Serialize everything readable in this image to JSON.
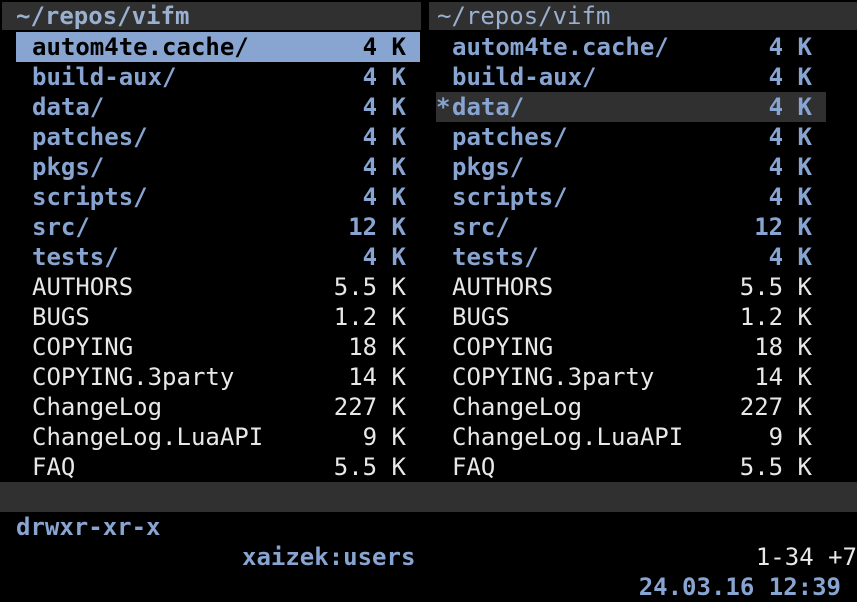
{
  "left_pane": {
    "path": "~/repos/vifm",
    "files": [
      {
        "name": "autom4te.cache/",
        "size": "4 K",
        "type": "dir",
        "cursor": true
      },
      {
        "name": "build-aux/",
        "size": "4 K",
        "type": "dir"
      },
      {
        "name": "data/",
        "size": "4 K",
        "type": "dir"
      },
      {
        "name": "patches/",
        "size": "4 K",
        "type": "dir"
      },
      {
        "name": "pkgs/",
        "size": "4 K",
        "type": "dir"
      },
      {
        "name": "scripts/",
        "size": "4 K",
        "type": "dir"
      },
      {
        "name": "src/",
        "size": "12 K",
        "type": "dir"
      },
      {
        "name": "tests/",
        "size": "4 K",
        "type": "dir"
      },
      {
        "name": "AUTHORS",
        "size": "5.5 K",
        "type": "file"
      },
      {
        "name": "BUGS",
        "size": "1.2 K",
        "type": "file"
      },
      {
        "name": "COPYING",
        "size": "18 K",
        "type": "file"
      },
      {
        "name": "COPYING.3party",
        "size": "14 K",
        "type": "file"
      },
      {
        "name": "ChangeLog",
        "size": "227 K",
        "type": "file"
      },
      {
        "name": "ChangeLog.LuaAPI",
        "size": "9 K",
        "type": "file"
      },
      {
        "name": "FAQ",
        "size": "5.5 K",
        "type": "file"
      }
    ]
  },
  "right_pane": {
    "path": "~/repos/vifm",
    "files": [
      {
        "name": "autom4te.cache/",
        "size": "4 K",
        "type": "dir"
      },
      {
        "name": "build-aux/",
        "size": "4 K",
        "type": "dir"
      },
      {
        "name": "data/",
        "size": "4 K",
        "type": "dir",
        "selected": true,
        "mark": "*"
      },
      {
        "name": "patches/",
        "size": "4 K",
        "type": "dir"
      },
      {
        "name": "pkgs/",
        "size": "4 K",
        "type": "dir"
      },
      {
        "name": "scripts/",
        "size": "4 K",
        "type": "dir"
      },
      {
        "name": "src/",
        "size": "12 K",
        "type": "dir"
      },
      {
        "name": "tests/",
        "size": "4 K",
        "type": "dir"
      },
      {
        "name": "AUTHORS",
        "size": "5.5 K",
        "type": "file"
      },
      {
        "name": "BUGS",
        "size": "1.2 K",
        "type": "file"
      },
      {
        "name": "COPYING",
        "size": "18 K",
        "type": "file"
      },
      {
        "name": "COPYING.3party",
        "size": "14 K",
        "type": "file"
      },
      {
        "name": "ChangeLog",
        "size": "227 K",
        "type": "file"
      },
      {
        "name": "ChangeLog.LuaAPI",
        "size": "9 K",
        "type": "file"
      },
      {
        "name": "FAQ",
        "size": "5.5 K",
        "type": "file"
      }
    ]
  },
  "status_bar": {
    "permissions": "drwxr-xr-x",
    "owner": "xaizek:users",
    "datetime": "24.03.16 12:39"
  },
  "command_line": {
    "position": "1-34 +7"
  },
  "colors": {
    "background": "#000000",
    "bar": "#303030",
    "directory": "#88a4d0",
    "file": "#e8e8e8",
    "cursor_bg": "#88a4d0"
  }
}
